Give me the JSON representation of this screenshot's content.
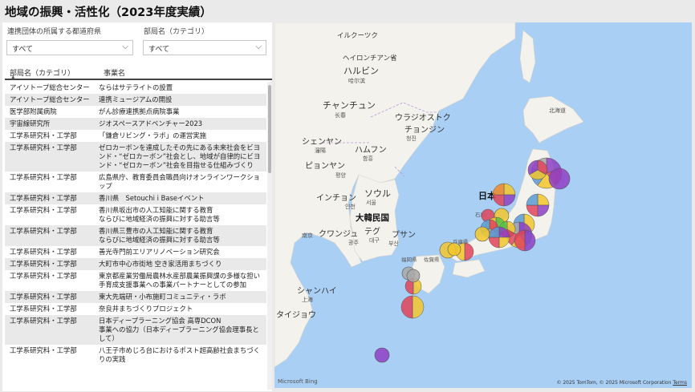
{
  "title": "地域の振興・活性化（2023年度実績）",
  "filters": [
    {
      "label": "連携団体の所属する都道府県",
      "value": "すべて"
    },
    {
      "label": "部局名（カテゴリ）",
      "value": "すべて"
    }
  ],
  "table": {
    "columns": [
      "部局名（カテゴリ）",
      "事業名"
    ],
    "rows": [
      [
        "アイソトープ総合センター",
        "ならはサテライトの設置"
      ],
      [
        "アイソトープ総合センター",
        "連携ミュージアムの開設"
      ],
      [
        "医学部附属病院",
        "がん診療連携拠点病院事業"
      ],
      [
        "宇宙線研究所",
        "ジオスペースアドベンチャー2023"
      ],
      [
        "工学系研究科・工学部",
        "「鎌倉リビング・ラボ」の運営実施"
      ],
      [
        "工学系研究科・工学部",
        "ゼロカーボンを達成したその先にある未来社会をビヨンド・“ゼロカーボン”社会とし、地域が自律的にビヨンド・“ゼロカーボン”社会を目指せる仕組みづくり"
      ],
      [
        "工学系研究科・工学部",
        "広島県庁、教育委員会職員向けオンラインワークショップ"
      ],
      [
        "工学系研究科・工学部",
        "香川県　Setouchi i Baseイベント"
      ],
      [
        "工学系研究科・工学部",
        "香川県坂出市の人工知能に関する教育\nならびに地域経済の振興に対する助言等"
      ],
      [
        "工学系研究科・工学部",
        "香川県三豊市の人工知能に関する教育\nならびに地域経済の振興に対する助言等"
      ],
      [
        "工学系研究科・工学部",
        "善光寺門前エリアリノベーション研究会"
      ],
      [
        "工学系研究科・工学部",
        "大町市中心市街地 空き家活用まちづくり"
      ],
      [
        "工学系研究科・工学部",
        "東京都産業労働局農林水産部農業振興課の多様な担い手育成支援事業への事業パートナーとしての参加"
      ],
      [
        "工学系研究科・工学部",
        "東大先端研・小布施町コミュニティ・ラボ"
      ],
      [
        "工学系研究科・工学部",
        "奈良井まちづくりプロジェクト"
      ],
      [
        "工学系研究科・工学部",
        "日本ディープラーニング協会 高専DCON\n事業への協力（日本ディープラーニング協会理事長として）"
      ],
      [
        "工学系研究科・工学部",
        "八王子市めじろ台におけるポスト超高齢社会まちづくりの実践"
      ]
    ]
  },
  "map": {
    "labels": {
      "irkutsk": "イルクーツク",
      "heilongjiang": "ヘイロンチアン省",
      "harbin": "ハルビン",
      "harbin_city": "哈尔滨",
      "changchun": "チャンチュン",
      "changchun_city": "长春",
      "vladivostok": "ウラジオストク",
      "chongjin": "チョンジン",
      "chongjin_city": "청진",
      "shenyang": "シェンヤン",
      "shenyang_city": "瀋陽",
      "hamhung": "ハムフン",
      "hamhung_city": "함흥",
      "pyongyang": "ピョンヤン",
      "pyongyang_city": "평양",
      "incheon": "インチョン",
      "incheon_city": "인천",
      "seoul": "ソウル",
      "seoul_city": "서울",
      "korea": "大韓民国",
      "daegu": "テグ",
      "daegu_city": "대구",
      "busan": "プサン",
      "busan_city": "부산",
      "gwangju": "クワンジュ",
      "gwangju_city": "광주",
      "nanjing": "南京",
      "shanghai": "シャンハイ",
      "shanghai_city": "上海",
      "japan": "日本",
      "hokkaido": "北海道",
      "fukuoka": "福岡県",
      "saga": "佐賀県",
      "hyogo": "兵庫県",
      "ishikawa": "石川",
      "taizhou": "タイジョウ",
      "copyright": "© 2025 TomTom, © 2025 Microsoft Corporation",
      "terms": "Terms",
      "bing": "Microsoft Bing"
    },
    "colors": {
      "sea": "#a9cff5",
      "land": "#f4f2ec",
      "purple": "#8e3fc4",
      "yellow": "#f2c72b",
      "red": "#e0435a",
      "blue": "#5b9bd5",
      "green": "#5ac23f",
      "gray": "#a8a8a8",
      "orange": "#f08a24",
      "pink": "#e8579a"
    },
    "bubbles": [
      {
        "name": "北海道",
        "colors": [
          "purple",
          "red",
          "yellow",
          "blue",
          "gray"
        ],
        "r": 19
      },
      {
        "name": "北海道-2",
        "colors": [
          "purple"
        ],
        "r": 13
      },
      {
        "name": "青森",
        "colors": [
          "red",
          "yellow",
          "purple"
        ],
        "r": 12
      },
      {
        "name": "宮城",
        "colors": [
          "yellow",
          "purple",
          "red",
          "blue"
        ],
        "r": 14
      },
      {
        "name": "新潟",
        "colors": [
          "yellow",
          "purple",
          "red",
          "orange"
        ],
        "r": 14
      },
      {
        "name": "福島",
        "colors": [
          "yellow",
          "blue"
        ],
        "r": 13
      },
      {
        "name": "石川",
        "colors": [
          "red"
        ],
        "r": 8
      },
      {
        "name": "富山",
        "colors": [
          "yellow"
        ],
        "r": 9
      },
      {
        "name": "長野",
        "colors": [
          "green",
          "red",
          "yellow"
        ],
        "r": 12
      },
      {
        "name": "東京",
        "colors": [
          "purple",
          "blue",
          "yellow",
          "red",
          "gray"
        ],
        "r": 16
      },
      {
        "name": "神奈川",
        "colors": [
          "purple",
          "red"
        ],
        "r": 13
      },
      {
        "name": "愛知",
        "colors": [
          "yellow",
          "red",
          "green"
        ],
        "r": 10
      },
      {
        "name": "京都",
        "colors": [
          "red",
          "gray",
          "blue"
        ],
        "r": 11
      },
      {
        "name": "大阪",
        "colors": [
          "purple",
          "yellow",
          "red",
          "blue"
        ],
        "r": 13
      },
      {
        "name": "兵庫",
        "colors": [
          "yellow"
        ],
        "r": 9
      },
      {
        "name": "広島",
        "colors": [
          "yellow"
        ],
        "r": 10
      },
      {
        "name": "香川",
        "colors": [
          "red",
          "yellow"
        ],
        "r": 11
      },
      {
        "name": "愛媛",
        "colors": [
          "yellow"
        ],
        "r": 8
      },
      {
        "name": "福岡",
        "colors": [
          "gray"
        ],
        "r": 8
      },
      {
        "name": "長崎",
        "colors": [
          "yellow",
          "red"
        ],
        "r": 10
      },
      {
        "name": "熊本",
        "colors": [
          "gray"
        ],
        "r": 8
      },
      {
        "name": "鹿児島",
        "colors": [
          "yellow",
          "red"
        ],
        "r": 14
      },
      {
        "name": "沖縄",
        "colors": [
          "purple"
        ],
        "r": 9
      }
    ]
  }
}
